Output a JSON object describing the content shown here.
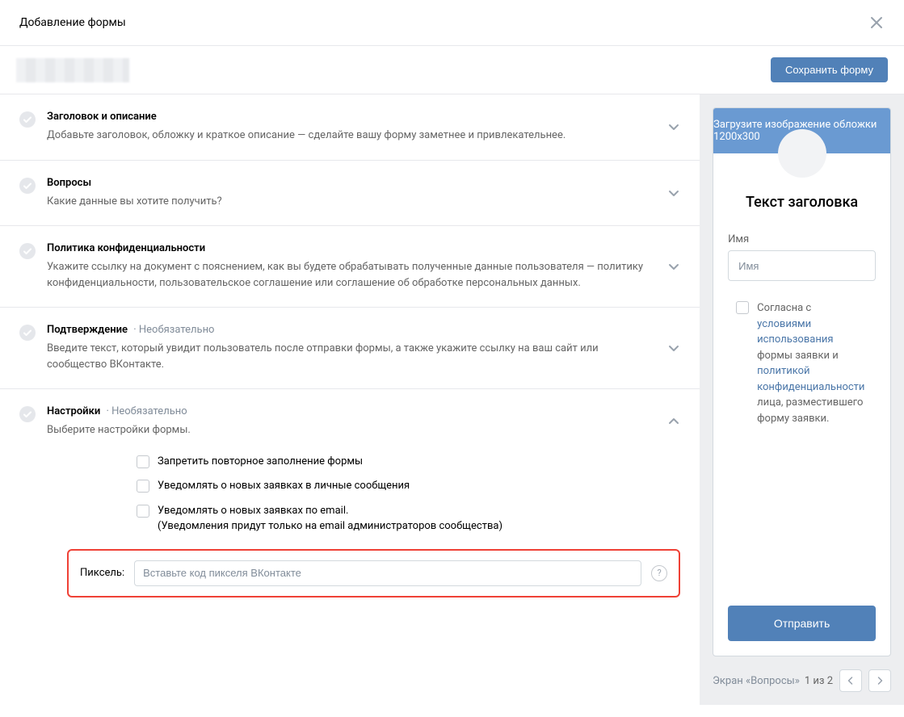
{
  "modal": {
    "title": "Добавление формы",
    "save_button": "Сохранить форму"
  },
  "sections": {
    "header": {
      "title": "Заголовок и описание",
      "desc": "Добавьте заголовок, обложку и краткое описание — сделайте вашу форму заметнее и привлекательнее."
    },
    "questions": {
      "title": "Вопросы",
      "desc": "Какие данные вы хотите получить?"
    },
    "privacy": {
      "title": "Политика конфиденциальности",
      "desc": "Укажите ссылку на документ с пояснением, как вы будете обрабатывать полученные данные пользователя — политику конфиденциальности, пользовательское соглашение или соглашение об обработке персональных данных."
    },
    "confirmation": {
      "title": "Подтверждение",
      "optional": "· Необязательно",
      "desc": "Введите текст, который увидит пользователь после отправки формы, а также укажите ссылку на ваш сайт или сообщество ВКонтакте."
    },
    "settings": {
      "title": "Настройки",
      "optional": "· Необязательно",
      "desc": "Выберите настройки формы.",
      "checks": {
        "no_repeat": "Запретить повторное заполнение формы",
        "notify_pm": "Уведомлять о новых заявках в личные сообщения",
        "notify_email": "Уведомлять о новых заявках по email.",
        "notify_email_note": "(Уведомления придут только на email администраторов сообщества)"
      },
      "pixel": {
        "label": "Пиксель:",
        "placeholder": "Вставьте код пикселя ВКонтакте",
        "help": "?"
      }
    }
  },
  "preview": {
    "cover_text": "Загрузите изображение обложки 1200x300",
    "form_title": "Текст заголовка",
    "name_label": "Имя",
    "name_placeholder": "Имя",
    "consent": {
      "pre": "Согласна с ",
      "link1": "условиями использования",
      "mid1": " формы заявки и ",
      "link2": "политикой конфиденциальности",
      "post": " лица, разместившего форму заявки."
    },
    "submit": "Отправить",
    "footer_label": "Экран «Вопросы»",
    "page_info": "1 из 2"
  }
}
